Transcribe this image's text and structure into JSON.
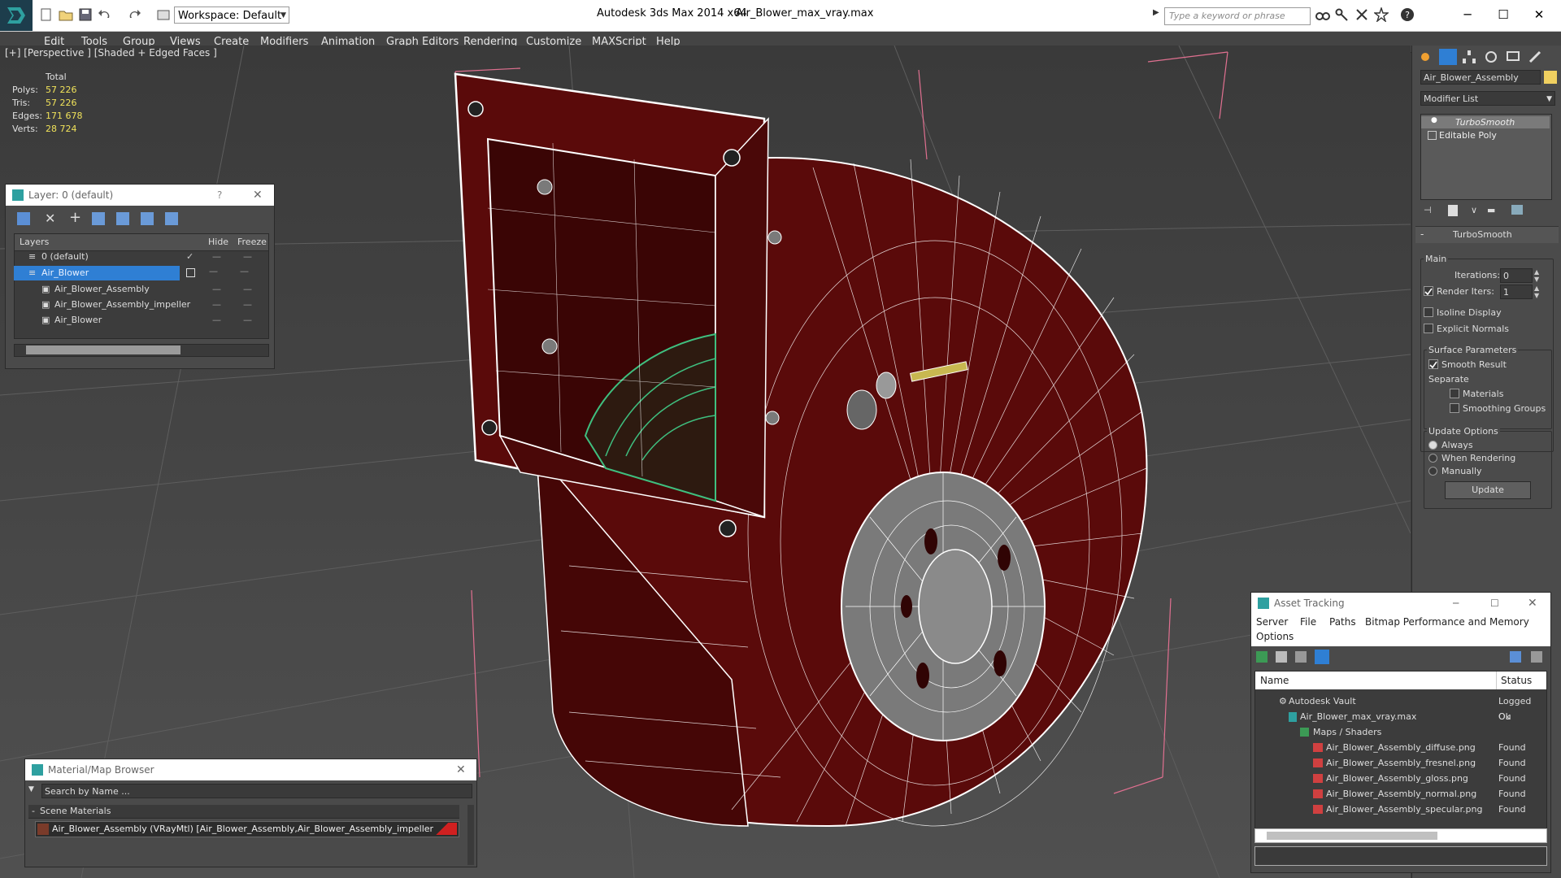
{
  "titlebar": {
    "workspace": "Workspace: Default",
    "app_name": "Autodesk 3ds Max  2014 x64",
    "file_name": "Air_Blower_max_vray.max",
    "search_placeholder": "Type a keyword or phrase"
  },
  "menu": [
    "Edit",
    "Tools",
    "Group",
    "Views",
    "Create",
    "Modifiers",
    "Animation",
    "Graph Editors",
    "Rendering",
    "Customize",
    "MAXScript",
    "Help"
  ],
  "viewport": {
    "label": "[+] [Perspective ] [Shaded + Edged Faces ]",
    "stats": {
      "header": "Total",
      "rows": [
        {
          "label": "Polys:",
          "value": "57 226"
        },
        {
          "label": "Tris:",
          "value": "57 226"
        },
        {
          "label": "Edges:",
          "value": "171 678"
        },
        {
          "label": "Verts:",
          "value": "28 724"
        }
      ]
    }
  },
  "layer_explorer": {
    "title": "Layer: 0 (default)",
    "col_layers": "Layers",
    "col_hide": "Hide",
    "col_freeze": "Freeze",
    "rows": [
      {
        "name": "0 (default)",
        "indent": 1
      },
      {
        "name": "Air_Blower",
        "indent": 1,
        "selected": true
      },
      {
        "name": "Air_Blower_Assembly",
        "indent": 2
      },
      {
        "name": "Air_Blower_Assembly_impeller",
        "indent": 2
      },
      {
        "name": "Air_Blower",
        "indent": 2
      }
    ]
  },
  "command_panel": {
    "object_name": "Air_Blower_Assembly",
    "modifier_list": "Modifier List",
    "stack": [
      "TurboSmooth",
      "Editable Poly"
    ],
    "rollout_title": "TurboSmooth",
    "main": "Main",
    "iterations_label": "Iterations:",
    "iterations": "0",
    "render_iters_label": "Render Iters:",
    "render_iters": "1",
    "isoline": "Isoline Display",
    "explicit_normals": "Explicit Normals",
    "surface_params": "Surface Parameters",
    "smooth_result": "Smooth Result",
    "separate": "Separate",
    "materials": "Materials",
    "smoothing_groups": "Smoothing Groups",
    "update_options": "Update Options",
    "always": "Always",
    "when_rendering": "When Rendering",
    "manually": "Manually",
    "update_button": "Update"
  },
  "asset_tracking": {
    "title": "Asset Tracking",
    "menu": [
      "Server",
      "File",
      "Paths",
      "Bitmap Performance and Memory"
    ],
    "menu2": "Options",
    "col_name": "Name",
    "col_status": "Status",
    "rows": [
      {
        "name": "Autodesk Vault",
        "status": "Logged Ou",
        "indent": 1
      },
      {
        "name": "Air_Blower_max_vray.max",
        "status": "Ok",
        "indent": 2
      },
      {
        "name": "Maps / Shaders",
        "status": "",
        "indent": 3
      },
      {
        "name": "Air_Blower_Assembly_diffuse.png",
        "status": "Found",
        "indent": 4
      },
      {
        "name": "Air_Blower_Assembly_fresnel.png",
        "status": "Found",
        "indent": 4
      },
      {
        "name": "Air_Blower_Assembly_gloss.png",
        "status": "Found",
        "indent": 4
      },
      {
        "name": "Air_Blower_Assembly_normal.png",
        "status": "Found",
        "indent": 4
      },
      {
        "name": "Air_Blower_Assembly_specular.png",
        "status": "Found",
        "indent": 4
      }
    ]
  },
  "material_browser": {
    "title": "Material/Map Browser",
    "search_placeholder": "Search by Name ...",
    "section": "Scene Materials",
    "item": "Air_Blower_Assembly  (VRayMtl) [Air_Blower_Assembly,Air_Blower_Assembly_impeller]"
  },
  "colors": {
    "model_face": "#5a0a0a",
    "wire": "#ffffff",
    "impeller": "#3fbf7f",
    "selection": "#2f7fd4",
    "stat_value": "#f0e25a"
  }
}
